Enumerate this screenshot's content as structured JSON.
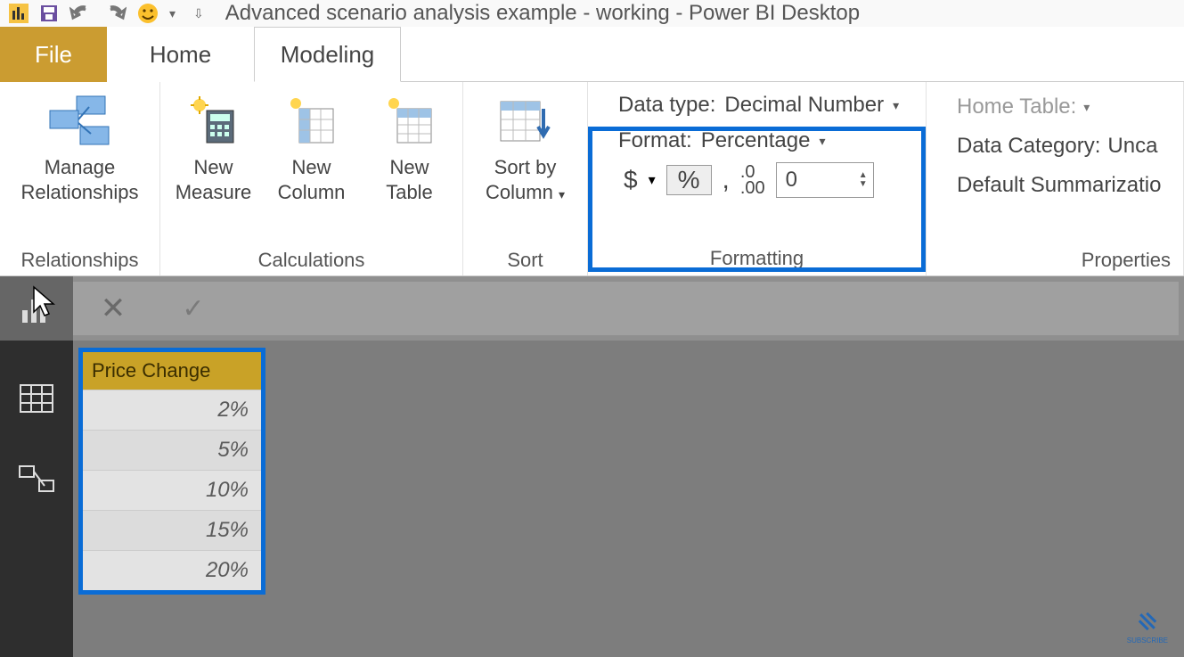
{
  "title": "Advanced scenario analysis example - working - Power BI Desktop",
  "tabs": {
    "file": "File",
    "home": "Home",
    "modeling": "Modeling"
  },
  "ribbon": {
    "relationships": {
      "manage": "Manage\nRelationships",
      "group": "Relationships"
    },
    "calculations": {
      "measure": "New\nMeasure",
      "column": "New\nColumn",
      "table": "New\nTable",
      "group": "Calculations"
    },
    "sort": {
      "btn": "Sort by\nColumn",
      "group": "Sort"
    },
    "formatting": {
      "datatype_label": "Data type:",
      "datatype_value": "Decimal Number",
      "format_label": "Format:",
      "format_value": "Percentage",
      "currency": "$",
      "percent": "%",
      "comma": ",",
      "decimal_icon": ".0\n.00",
      "decimal_value": "0",
      "group": "Formatting"
    },
    "properties": {
      "home_table": "Home Table:",
      "category_label": "Data Category:",
      "category_value": "Unca",
      "summarize": "Default Summarizatio",
      "group": "Properties"
    }
  },
  "table": {
    "header": "Price Change",
    "rows": [
      "2%",
      "5%",
      "10%",
      "15%",
      "20%"
    ]
  },
  "subscribe": "SUBSCRIBE"
}
